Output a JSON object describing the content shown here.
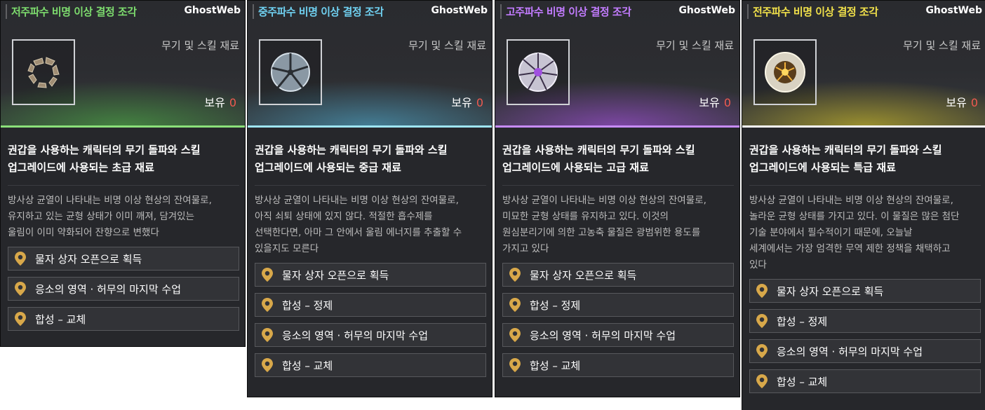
{
  "cards": [
    {
      "title": "저주파수 비명 이상 결정 조각",
      "watermark": "GhostWeb",
      "category": "무기 및 스킬 재료",
      "owned_label": "보유",
      "owned_count": "0",
      "summary_line1": "권갑을 사용하는 캐릭터의 무기 돌파와 스킬",
      "summary_line2": "업그레이드에 사용되는 초급 재료",
      "lore_lines": [
        "방사상 균열이 나타내는 비명 이상 현상의 잔여물로,",
        "유지하고 있는 균형 상태가 이미 깨져, 담겨있는",
        "울림이 이미 약화되어 잔향으로 변했다"
      ],
      "sources": [
        "물자 상자 오픈으로 획득",
        "응소의 영역 · 허무의 마지막 수업",
        "합성 – 교체"
      ]
    },
    {
      "title": "중주파수 비명 이상 결정 조각",
      "watermark": "GhostWeb",
      "category": "무기 및 스킬 재료",
      "owned_label": "보유",
      "owned_count": "0",
      "summary_line1": "권갑을 사용하는 캐릭터의 무기 돌파와 스킬",
      "summary_line2": "업그레이드에 사용되는 중급 재료",
      "lore_lines": [
        "방사상 균열이 나타내는 비명 이상 현상의 잔여물로,",
        "아직 쇠퇴 상태에 있지 않다. 적절한 흡수제를",
        "선택한다면, 아마 그 안에서 울림 에너지를 추출할 수",
        "있을지도 모른다"
      ],
      "sources": [
        "물자 상자 오픈으로 획득",
        "합성 – 정제",
        "응소의 영역 · 허무의 마지막 수업",
        "합성 – 교체"
      ]
    },
    {
      "title": "고주파수 비명 이상 결정 조각",
      "watermark": "GhostWeb",
      "category": "무기 및 스킬 재료",
      "owned_label": "보유",
      "owned_count": "0",
      "summary_line1": "권갑을 사용하는 캐릭터의 무기 돌파와 스킬",
      "summary_line2": "업그레이드에 사용되는 고급 재료",
      "lore_lines": [
        "방사상 균열이 나타내는 비명 이상 현상의 잔여물로,",
        "미묘한 균형 상태를 유지하고 있다. 이것의",
        "원심분리기에 의한 고농축 물질은 광범위한 용도를",
        "가지고 있다"
      ],
      "sources": [
        "물자 상자 오픈으로 획득",
        "합성 – 정제",
        "응소의 영역 · 허무의 마지막 수업",
        "합성 – 교체"
      ]
    },
    {
      "title": "전주파수 비명 이상 결정 조각",
      "watermark": "GhostWeb",
      "category": "무기 및 스킬 재료",
      "owned_label": "보유",
      "owned_count": "0",
      "summary_line1": "권갑을 사용하는 캐릭터의 무기 돌파와 스킬",
      "summary_line2": "업그레이드에 사용되는 특급 재료",
      "lore_lines": [
        "방사상 균열이 나타내는 비명 이상 현상의 잔여물로,",
        "놀라운 균형 상태를 가지고 있다. 이 물질은 많은 첨단",
        "기술 분야에서 필수적이기 때문에, 오늘날",
        "세계에서는 가장 엄격한 무역 제한 정책을 채택하고",
        "있다"
      ],
      "sources": [
        "물자 상자 오픈으로 획득",
        "합성 – 정제",
        "응소의 영역 · 허무의 마지막 수업",
        "합성 – 교체"
      ]
    }
  ],
  "theme": {
    "card_colors": [
      "#7ddc6e",
      "#6fd0f0",
      "#c27cff",
      "#f0e04a"
    ],
    "icon_names": [
      "crystal-fragment-low-icon",
      "crystal-fragment-mid-icon",
      "crystal-fragment-high-icon",
      "crystal-fragment-full-icon"
    ],
    "source_icon": "map-pin-icon"
  }
}
